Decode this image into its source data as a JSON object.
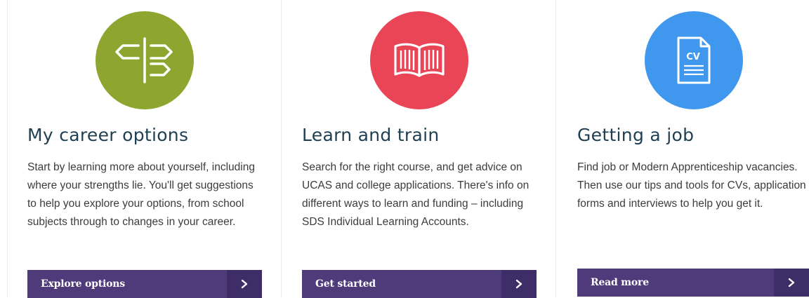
{
  "colors": {
    "career_circle": "#8ea62f",
    "learn_circle": "#ea4556",
    "job_circle": "#3f97ee",
    "heading": "#1f3f52",
    "body_text": "#3c3c3c",
    "button_bg": "#4f3a7a",
    "button_arrow_bg": "#3f2d67"
  },
  "cards": [
    {
      "icon": "signpost-icon",
      "title": "My career options",
      "text": "Start by learning more about yourself, including where your strengths lie. You'll get suggestions to help you explore your options, from school subjects through to changes in your career.",
      "button_label": "Explore options",
      "button_icon": "chevron-right-icon"
    },
    {
      "icon": "open-book-icon",
      "title": "Learn and train",
      "text": "Search for the right course, and get advice on UCAS and college applications. There's info on different ways to learn and funding – including SDS Individual Learning Accounts.",
      "button_label": "Get started",
      "button_icon": "chevron-right-icon"
    },
    {
      "icon": "cv-document-icon",
      "icon_text": "CV",
      "title": "Getting a job",
      "text": "Find job or Modern Apprenticeship vacancies. Then use our tips and tools for CVs, application forms and interviews to help you get it.",
      "button_label": "Read more",
      "button_icon": "chevron-right-icon"
    }
  ]
}
